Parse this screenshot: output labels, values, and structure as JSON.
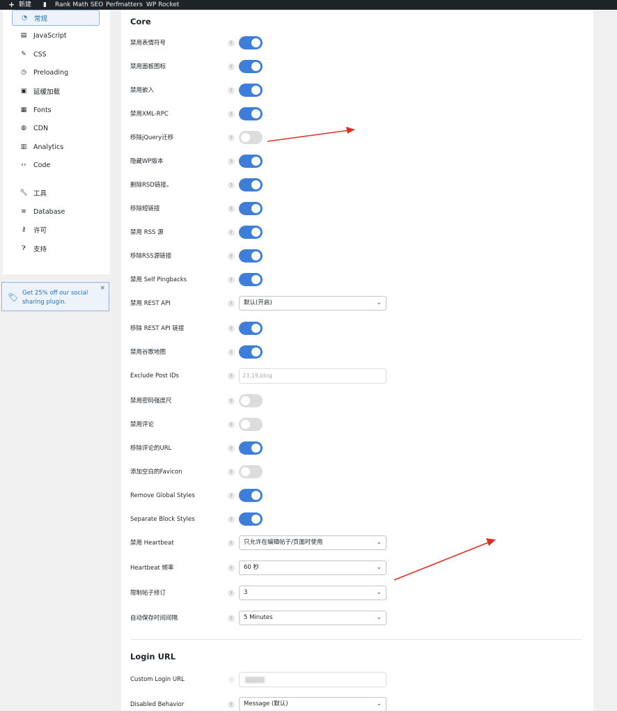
{
  "admin_bar": {
    "new_label": "新建",
    "items": [
      "Rank Math SEO",
      "Perfmatters",
      "WP Rocket"
    ]
  },
  "sidebar": {
    "items": [
      {
        "label": "常规",
        "icon": "dashboard-icon",
        "active": true
      },
      {
        "label": "JavaScript",
        "icon": "file-icon"
      },
      {
        "label": "CSS",
        "icon": "brush-icon"
      },
      {
        "label": "Preloading",
        "icon": "clock-icon"
      },
      {
        "label": "延缓加载",
        "icon": "image-icon"
      },
      {
        "label": "Fonts",
        "icon": "fonts-icon"
      },
      {
        "label": "CDN",
        "icon": "globe-icon"
      },
      {
        "label": "Analytics",
        "icon": "chart-icon"
      },
      {
        "label": "Code",
        "icon": "code-icon"
      },
      {
        "label": "工具",
        "icon": "wrench-icon"
      },
      {
        "label": "Database",
        "icon": "database-icon"
      },
      {
        "label": "许可",
        "icon": "key-icon"
      },
      {
        "label": "支持",
        "icon": "question-icon"
      }
    ]
  },
  "promo": {
    "text": "Get 25% off our social sharing plugin.",
    "close": "×"
  },
  "core": {
    "title": "Core",
    "rows": [
      {
        "label": "禁用表情符号",
        "type": "toggle",
        "on": true
      },
      {
        "label": "禁用面板图标",
        "type": "toggle",
        "on": true
      },
      {
        "label": "禁用嵌入",
        "type": "toggle",
        "on": true
      },
      {
        "label": "禁用XML-RPC",
        "type": "toggle",
        "on": true
      },
      {
        "label": "移除jQuery迁移",
        "type": "toggle",
        "on": false
      },
      {
        "label": "隐藏WP版本",
        "type": "toggle",
        "on": true
      },
      {
        "label": "删除RSD链接。",
        "type": "toggle",
        "on": true
      },
      {
        "label": "移除短链接",
        "type": "toggle",
        "on": true
      },
      {
        "label": "禁用 RSS 源",
        "type": "toggle",
        "on": true
      },
      {
        "label": "移除RSS源链接",
        "type": "toggle",
        "on": true
      },
      {
        "label": "禁用 Self Pingbacks",
        "type": "toggle",
        "on": true
      },
      {
        "label": "禁用 REST API",
        "type": "select",
        "value": "默认(开启)"
      },
      {
        "label": "移除 REST API 链接",
        "type": "toggle",
        "on": true
      },
      {
        "label": "禁用谷歌地图",
        "type": "toggle",
        "on": true
      },
      {
        "label": "Exclude Post IDs",
        "type": "text",
        "placeholder": "23,19,blog"
      },
      {
        "label": "禁用密码强度尺",
        "type": "toggle",
        "on": false
      },
      {
        "label": "禁用评论",
        "type": "toggle",
        "on": false
      },
      {
        "label": "移除评论的URL",
        "type": "toggle",
        "on": true
      },
      {
        "label": "添加空白的Favicon",
        "type": "toggle",
        "on": false
      },
      {
        "label": "Remove Global Styles",
        "type": "toggle",
        "on": true
      },
      {
        "label": "Separate Block Styles",
        "type": "toggle",
        "on": true
      },
      {
        "label": "禁用 Heartbeat",
        "type": "select",
        "value": "只允许在编辑帖子/页面时使用"
      },
      {
        "label": "Heartbeat 频率",
        "type": "select",
        "value": "60 秒"
      },
      {
        "label": "限制帖子修订",
        "type": "select",
        "value": "3"
      },
      {
        "label": "自动保存时间间隔",
        "type": "select",
        "value": "5 Minutes"
      }
    ]
  },
  "login_url": {
    "title": "Login URL",
    "rows": [
      {
        "label": "Custom Login URL",
        "type": "text",
        "placeholder": ""
      },
      {
        "label": "Disabled Behavior",
        "type": "select",
        "value": "Message (默认)"
      }
    ]
  },
  "colors": {
    "toggle_on": "#3f7ed8",
    "toggle_off": "#dcdcde",
    "accent": "#2271b1",
    "annotation_arrow": "#d93025"
  }
}
